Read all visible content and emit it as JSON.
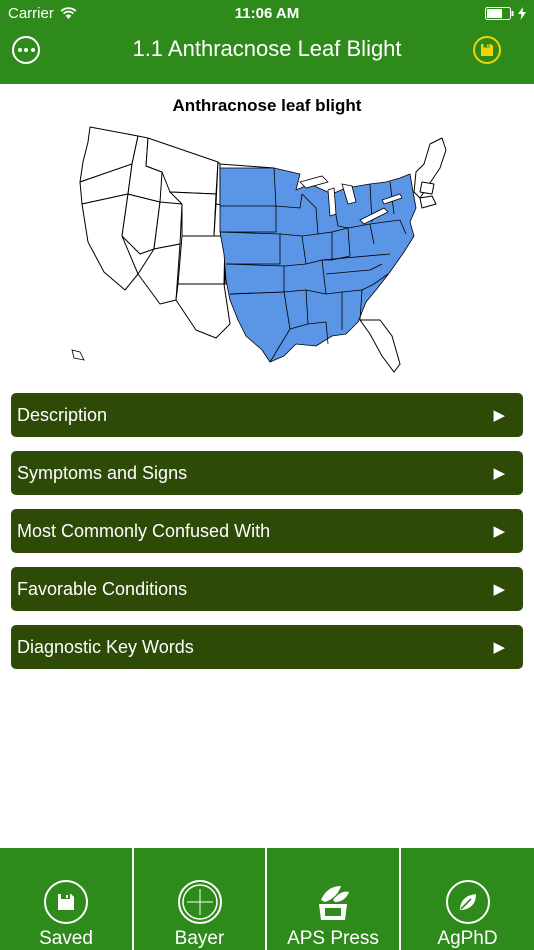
{
  "status": {
    "carrier": "Carrier",
    "time": "11:06 AM"
  },
  "nav": {
    "title": "1.1 Anthracnose Leaf Blight"
  },
  "map": {
    "title": "Anthracnose leaf blight"
  },
  "sections": [
    {
      "label": "Description"
    },
    {
      "label": "Symptoms and Signs"
    },
    {
      "label": "Most Commonly Confused With"
    },
    {
      "label": "Favorable Conditions"
    },
    {
      "label": "Diagnostic Key Words"
    }
  ],
  "tabs": [
    {
      "label": "Saved",
      "icon": "save-icon"
    },
    {
      "label": "Bayer",
      "icon": "bayer-logo-icon"
    },
    {
      "label": "APS Press",
      "icon": "aps-logo-icon"
    },
    {
      "label": "AgPhD",
      "icon": "leaf-icon"
    }
  ],
  "colors": {
    "bar_green": "#2f8a1c",
    "button_green": "#2e4a07",
    "region_blue": "#5b95e6",
    "save_yellow": "#f1d400"
  }
}
